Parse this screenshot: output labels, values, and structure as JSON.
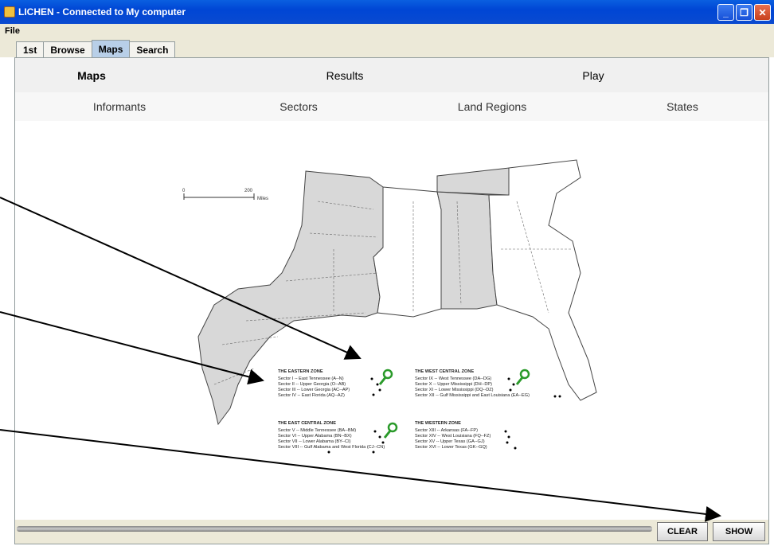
{
  "window": {
    "title": "LICHEN - Connected to My computer"
  },
  "menu": {
    "file": "File"
  },
  "tabs": [
    "1st",
    "Browse",
    "Maps",
    "Search"
  ],
  "nav_primary": [
    "Maps",
    "Results",
    "Play"
  ],
  "nav_secondary": [
    "Informants",
    "Sectors",
    "Land Regions",
    "States"
  ],
  "map": {
    "scale_zero": "0",
    "scale_200": "200",
    "scale_unit": "Miles",
    "legend": [
      {
        "title": "THE EASTERN ZONE",
        "lines": [
          "Sector I -- East Tennessee (A--N)",
          "Sector II -- Upper Georgia (O--AB)",
          "Sector III -- Lower Georgia (AC--AP)",
          "Sector IV -- East Florida (AQ--AZ)"
        ]
      },
      {
        "title": "THE WEST CENTRAL ZONE",
        "lines": [
          "Sector IX -- West Tennessee (DA--DG)",
          "Sector X -- Upper Mississippi (DH--DP)",
          "Sector XI -- Lower Mississippi (DQ--DZ)",
          "Sector XII -- Gulf Mississippi and East Louisiana (EA--EG)"
        ]
      },
      {
        "title": "THE EAST CENTRAL ZONE",
        "lines": [
          "Sector V -- Middle Tennessee (BA--BM)",
          "Sector VI -- Upper Alabama (BN--BX)",
          "Sector VII -- Lower Alabama (BY--CI)",
          "Sector VIII -- Gulf Alabama and West Florida (CJ--CN)"
        ]
      },
      {
        "title": "THE WESTERN ZONE",
        "lines": [
          "Sector XIII -- Arkansas (FA--FP)",
          "Sector XIV -- West Louisiana (FQ--FZ)",
          "Sector XV -- Upper Texas (GA--GJ)",
          "Sector XVI -- Lower Texas (GK--GQ)"
        ]
      }
    ]
  },
  "buttons": {
    "clear": "CLEAR",
    "show": "SHOW"
  },
  "colors": {
    "title_bar": "#0a4ad0",
    "shaded_region": "#d8d8d8",
    "pin": "#2a9a2a"
  }
}
